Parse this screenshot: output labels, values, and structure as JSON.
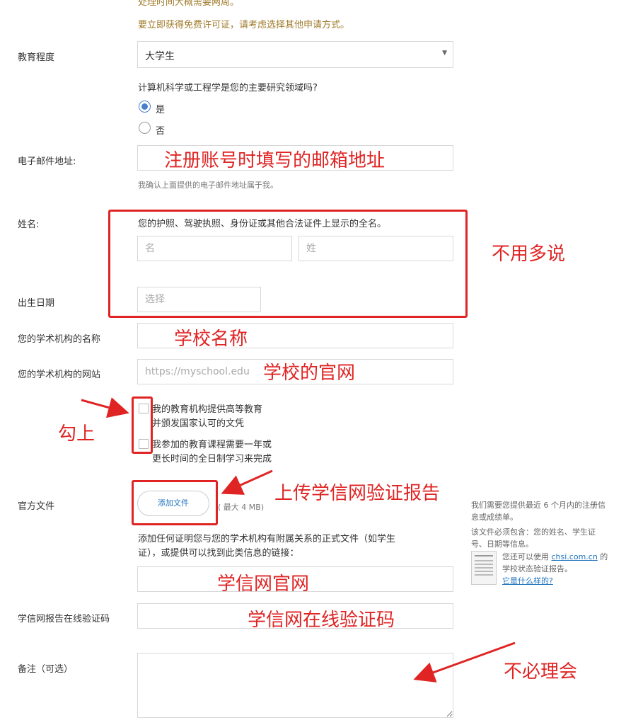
{
  "form": {
    "top_notice_cut": "处理时间大概需要两周。",
    "top_notice": "要立即获得免费许可证，请考虑选择其他申请方式。",
    "education": {
      "label": "教育程度",
      "selected": "大学生",
      "cs_question": "计算机科学或工程学是您的主要研究领域吗?",
      "options": [
        "是",
        "否"
      ],
      "selected_option": "是"
    },
    "email": {
      "label": "电子邮件地址:",
      "value": "",
      "confirm_note": "我确认上面提供的电子邮件地址属于我。"
    },
    "name": {
      "label": "姓名:",
      "hint": "您的护照、驾驶执照、身份证或其他合法证件上显示的全名。",
      "first_placeholder": "名",
      "last_placeholder": "姓"
    },
    "birthdate": {
      "label": "出生日期",
      "placeholder": "选择"
    },
    "institution_name": {
      "label": "您的学术机构的名称"
    },
    "institution_site": {
      "label": "您的学术机构的网站",
      "placeholder": "https://myschool.edu"
    },
    "checks": [
      {
        "line1": "我的教育机构提供高等教育",
        "line2": "并颁发国家认可的文凭"
      },
      {
        "line1": "我参加的教育课程需要一年或",
        "line2": "更长时间的全日制学习来完成"
      }
    ],
    "official_docs": {
      "label": "官方文件",
      "button": "添加文件",
      "max_size": "( 最大 4 MB)",
      "desc_line1": "添加任何证明您与您的学术机构有附属关系的正式文件（如学生",
      "desc_line2": "证），或提供可以找到此类信息的链接："
    },
    "chsi_code": {
      "label": "学信网报告在线验证码"
    },
    "notes": {
      "label": "备注（可选）"
    }
  },
  "sidebar": {
    "line1": "我们需要您提供最近 6 个月内的注册信",
    "line2": "息或成绩单。",
    "line3": "该文件必须包含：您的姓名、学生证",
    "line4": "号、日期等信息。",
    "chsi_prefix": "您还可以使用 ",
    "chsi_link": "chsi.com.cn",
    "chsi_suffix": " 的",
    "chsi_line2": "学校状态验证报告。",
    "what_link": "它是什么样的?"
  },
  "annotations": {
    "email": "注册账号时填写的邮箱地址",
    "no_need": "不用多说",
    "school_name": "学校名称",
    "school_site": "学校的官网",
    "check_it": "勾上",
    "upload": "上传学信网验证报告",
    "chsi_site": "学信网官网",
    "chsi_code": "学信网在线验证码",
    "ignore": "不必理会"
  },
  "colors": {
    "annotation_red": "#e02424",
    "notice_gold": "#a07a2a",
    "link_blue": "#1e73be",
    "radio_blue": "#4a7fd0"
  }
}
